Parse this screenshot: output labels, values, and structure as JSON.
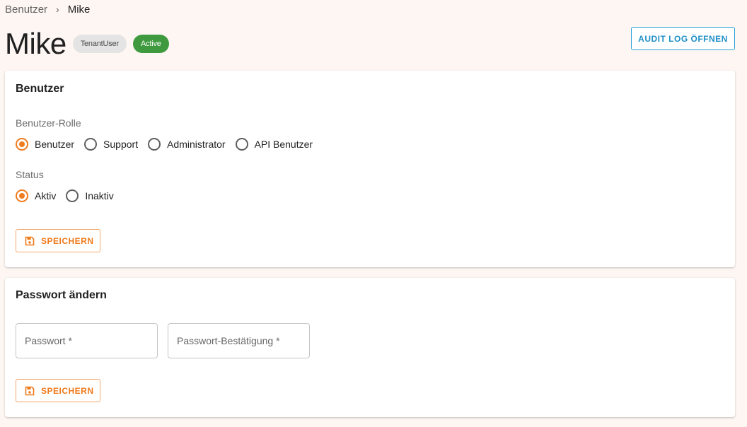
{
  "breadcrumb": {
    "parent": "Benutzer",
    "separator": "›",
    "current": "Mike"
  },
  "header": {
    "title": "Mike",
    "role_chip": "TenantUser",
    "status_chip": "Active",
    "audit_button": "AUDIT LOG ÖFFNEN"
  },
  "user_card": {
    "title": "Benutzer",
    "role_label": "Benutzer-Rolle",
    "roles": [
      {
        "label": "Benutzer",
        "selected": true
      },
      {
        "label": "Support",
        "selected": false
      },
      {
        "label": "Administrator",
        "selected": false
      },
      {
        "label": "API Benutzer",
        "selected": false
      }
    ],
    "status_label": "Status",
    "statuses": [
      {
        "label": "Aktiv",
        "selected": true
      },
      {
        "label": "Inaktiv",
        "selected": false
      }
    ],
    "save_label": "SPEICHERN"
  },
  "password_card": {
    "title": "Passwort ändern",
    "password_placeholder": "Passwort *",
    "password_confirm_placeholder": "Passwort-Bestätigung *",
    "save_label": "SPEICHERN"
  },
  "colors": {
    "accent": "#f07c1e",
    "link_blue": "#1e8fc7",
    "status_active": "#3f9a3f",
    "background": "#fdf6f2"
  },
  "icons": {
    "save": "floppy-disk-icon",
    "breadcrumb_sep": "chevron-right-icon"
  }
}
